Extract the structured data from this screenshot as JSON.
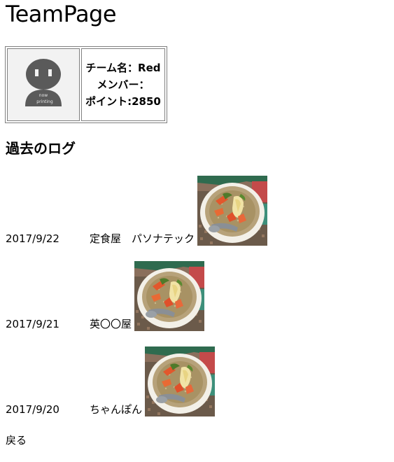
{
  "header": {
    "title": "TeamPage"
  },
  "team": {
    "avatar_text_line1": "now",
    "avatar_text_line2": "printing",
    "name_line": "チーム名：Red",
    "members_line": "メンバー：",
    "points_line": "ポイント:2850"
  },
  "logs": {
    "heading": "過去のログ",
    "items": [
      {
        "date": "2017/9/22",
        "place": "定食屋　パソナテック",
        "image": "soup-photo"
      },
      {
        "date": "2017/9/21",
        "place": "英〇〇屋",
        "image": "soup-photo"
      },
      {
        "date": "2017/9/20",
        "place": "ちゃんぽん",
        "image": "soup-photo"
      }
    ]
  },
  "footer": {
    "back_label": "戻る"
  }
}
